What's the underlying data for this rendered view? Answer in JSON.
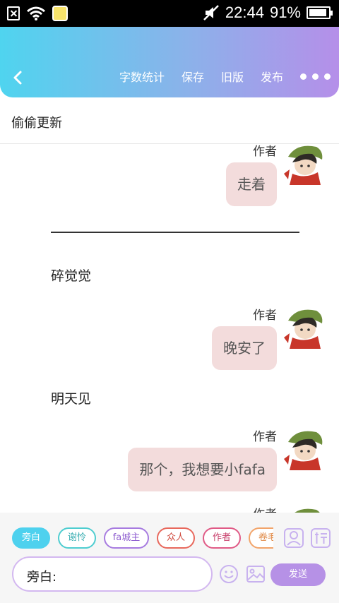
{
  "status_bar": {
    "time": "22:44",
    "battery": "91%",
    "battery_level": 0.91
  },
  "header": {
    "menu": [
      {
        "label": "字数统计"
      },
      {
        "label": "保存"
      },
      {
        "label": "旧版"
      },
      {
        "label": "发布"
      }
    ]
  },
  "title": "偷偷更新",
  "chat": {
    "messages": [
      {
        "type": "author",
        "name": "作者",
        "text": "走着"
      },
      {
        "type": "narration",
        "text": "碎觉觉"
      },
      {
        "type": "author",
        "name": "作者",
        "text": "晚安了"
      },
      {
        "type": "narration",
        "text": "明天见"
      },
      {
        "type": "author",
        "name": "作者",
        "text": "那个，我想要小fafa"
      },
      {
        "type": "author",
        "name": "作者",
        "text": ""
      }
    ]
  },
  "composer": {
    "chips": [
      {
        "label": "旁白",
        "color": "#4ed1ee"
      },
      {
        "label": "谢怜",
        "color": "#4ecdd0"
      },
      {
        "label": "fa城主",
        "color": "#a77be0"
      },
      {
        "label": "众人",
        "color": "#e8685c"
      },
      {
        "label": "作者",
        "color": "#e05a86"
      },
      {
        "label": "卷毛",
        "color": "#f2a46a"
      }
    ],
    "input_label": "旁白:",
    "send_label": "发送"
  },
  "colors": {
    "accent": "#b691e6",
    "bubble": "#f3dcdc",
    "header_start": "#4fd4ef",
    "header_end": "#b58fe9"
  }
}
